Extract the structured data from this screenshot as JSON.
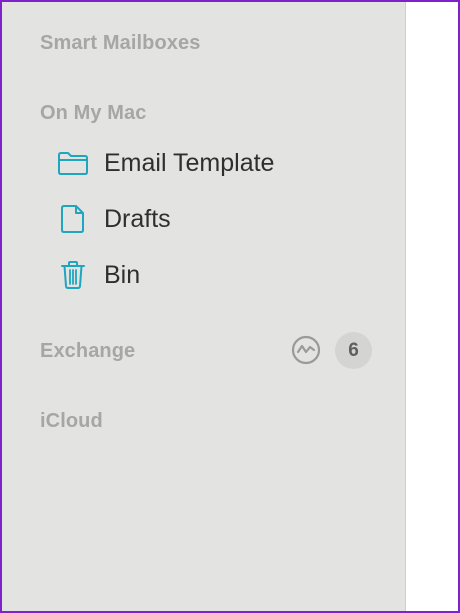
{
  "sidebar": {
    "sections": {
      "smart_mailboxes": "Smart Mailboxes",
      "on_my_mac": "On My Mac",
      "exchange": "Exchange",
      "icloud": "iCloud"
    },
    "on_my_mac_items": [
      {
        "label": "Email Template",
        "icon": "folder-icon"
      },
      {
        "label": "Drafts",
        "icon": "document-icon"
      },
      {
        "label": "Bin",
        "icon": "trash-icon"
      }
    ],
    "exchange_badge": "6",
    "exchange_status_icon": "activity-icon"
  },
  "colors": {
    "accent": "#1ea6bf",
    "sidebar_bg": "#e3e3e2",
    "frame_border": "#7e22c9"
  }
}
